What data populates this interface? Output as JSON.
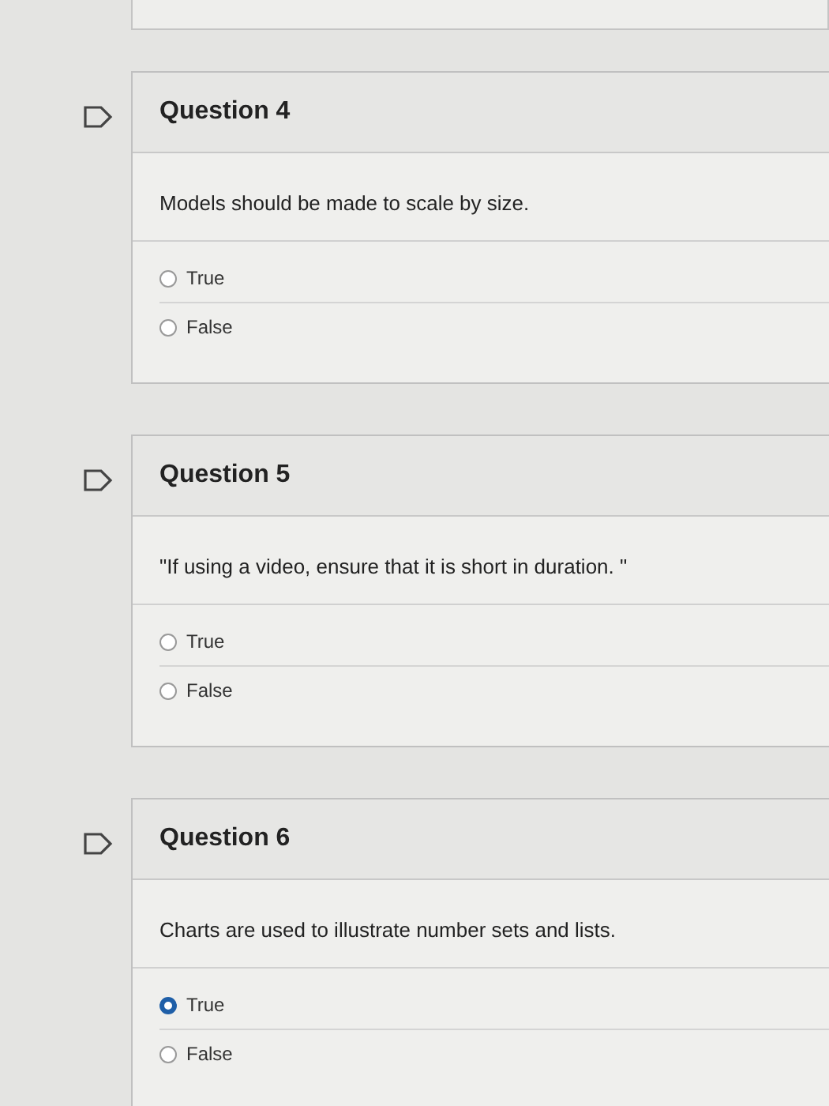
{
  "questions": [
    {
      "title": "Question 4",
      "text": "Models should be made to scale by size.",
      "options": [
        {
          "label": "True",
          "selected": false
        },
        {
          "label": "False",
          "selected": false
        }
      ]
    },
    {
      "title": "Question 5",
      "text": "\"If using a video, ensure that it is short in duration. \"",
      "options": [
        {
          "label": "True",
          "selected": false
        },
        {
          "label": "False",
          "selected": false
        }
      ]
    },
    {
      "title": "Question 6",
      "text": "Charts are used to illustrate number sets and lists.",
      "options": [
        {
          "label": "True",
          "selected": true
        },
        {
          "label": "False",
          "selected": false
        }
      ]
    }
  ]
}
